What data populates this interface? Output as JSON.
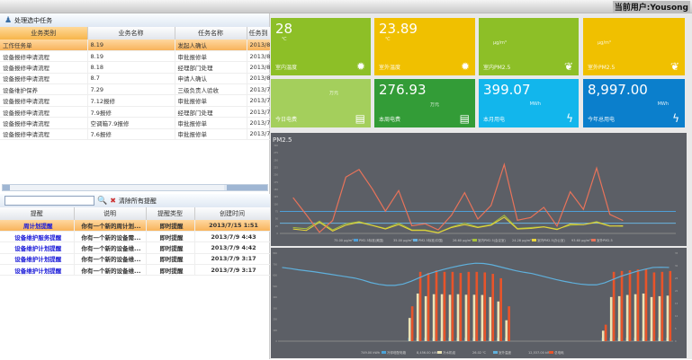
{
  "header": {
    "user": "当前用户:Yousong"
  },
  "tasks": {
    "toolbar_label": "处理选中任务",
    "columns": [
      "业务类别",
      "业务名称",
      "任务名称",
      "任务到"
    ],
    "rows": [
      [
        "工作任务单",
        "8.19",
        "发起人确认",
        "2013/8"
      ],
      [
        "设备报修申请流程",
        "8.19",
        "审批报修单",
        "2013/8"
      ],
      [
        "设备报修申请流程",
        "8.18",
        "经理部门处理",
        "2013/8"
      ],
      [
        "设备报修申请流程",
        "8.7",
        "申请人确认",
        "2013/8"
      ],
      [
        "设备维护保养",
        "7.29",
        "三级负责人验收",
        "2013/7"
      ],
      [
        "设备报修申请流程",
        "7.12报修",
        "审批报修单",
        "2013/7"
      ],
      [
        "设备报修申请流程",
        "7.9报修",
        "经理部门处理",
        "2013/7"
      ],
      [
        "设备报修申请流程",
        "空调箱7.9报修",
        "审批报修单",
        "2013/7"
      ],
      [
        "设备报修申请流程",
        "7.6报修",
        "审批报修单",
        "2013/7"
      ]
    ]
  },
  "reminders": {
    "search_value": "",
    "clear_label": "清除所有提醒",
    "columns": [
      "提醒",
      "说明",
      "提醒类型",
      "创建时间"
    ],
    "rows": [
      [
        "周计划提醒",
        "你有一个新的周计划...",
        "即时提醒",
        "2013/7/15 1:51"
      ],
      [
        "设备维护服务提醒",
        "你有一个新的设备需...",
        "即时提醒",
        "2013/7/9 4:43"
      ],
      [
        "设备维护计划提醒",
        "你有一个新的设备维...",
        "即时提醒",
        "2013/7/9 4:42"
      ],
      [
        "设备维护计划提醒",
        "你有一个新的设备维...",
        "即时提醒",
        "2013/7/9 3:17"
      ],
      [
        "设备维护计划提醒",
        "你有一个新的设备维...",
        "即时提醒",
        "2013/7/9 3:17"
      ]
    ]
  },
  "tiles": [
    {
      "value": "28",
      "unit": "℃",
      "label": "室内温度",
      "icon": "sun-icon",
      "color": "#8dbf27"
    },
    {
      "value": "23.89",
      "unit": "℃",
      "label": "室外温度",
      "icon": "sun-icon",
      "color": "#f0c000"
    },
    {
      "value": "",
      "unit": "μg/m³",
      "label": "室内PM2.5",
      "icon": "leaf-icon",
      "color": "#8dbf27"
    },
    {
      "value": "",
      "unit": "μg/m³",
      "label": "室外PM2.5",
      "icon": "leaf-icon",
      "color": "#f0c000"
    },
    {
      "value": "",
      "unit": "万元",
      "label": "今日电费",
      "icon": "money-icon",
      "color": "#a4cf5c"
    },
    {
      "value": "276.93",
      "unit": "万元",
      "label": "本周电费",
      "icon": "money-icon",
      "color": "#339c37"
    },
    {
      "value": "399.07",
      "unit": "MWh",
      "label": "本月用电",
      "icon": "lightning-icon",
      "color": "#12b6ec"
    },
    {
      "value": "8,997.00",
      "unit": "MWh",
      "label": "今年总用电",
      "icon": "lightning-icon",
      "color": "#0b7fcc"
    }
  ],
  "chart_data": [
    {
      "type": "line",
      "title": "PM2.5",
      "ylim": [
        0,
        300
      ],
      "grid": false,
      "legend": "bottom",
      "reference_lines": [
        {
          "name": "PM2.5标准(美国)",
          "value": 75,
          "legend_value": "75.00 μg/m³",
          "color": "#4f9fd8"
        },
        {
          "name": "PM2.5标准(中国)",
          "value": 35,
          "legend_value": "35.00 μg/m³",
          "color": "#6ab2e0"
        }
      ],
      "series": [
        {
          "name": "室内PM2.5(会议室)",
          "legend_value": "26.60 μg/m³",
          "color": "#a8c23a",
          "values": [
            20,
            16,
            42,
            12,
            33,
            40,
            28,
            17,
            35,
            12,
            12,
            3,
            22,
            35,
            22,
            30,
            62,
            17,
            20,
            23,
            15,
            28,
            30,
            40,
            26,
            24
          ]
        },
        {
          "name": "室内PM2.5(办公室)",
          "legend_value": "24.28 μg/m³",
          "color": "#e8d43c",
          "values": [
            15,
            10,
            38,
            8,
            28,
            38,
            27,
            15,
            30,
            10,
            10,
            2,
            20,
            30,
            20,
            28,
            55,
            15,
            17,
            22,
            13,
            32,
            30,
            38,
            25,
            26
          ]
        },
        {
          "name": "室外PM2.5",
          "legend_value": "93.60 μg/m³",
          "color": "#e8735a",
          "values": [
            122,
            64,
            4,
            44,
            192,
            218,
            152,
            76,
            146,
            26,
            33,
            12,
            62,
            139,
            49,
            95,
            235,
            45,
            54,
            89,
            25,
            142,
            82,
            223,
            65,
            44
          ]
        }
      ]
    },
    {
      "type": "bar",
      "ylim": [
        0,
        800
      ],
      "y2lim": [
        0,
        35
      ],
      "grid": false,
      "legend": "bottom",
      "series": [
        {
          "name": "冷却塔配电箱",
          "legend_value": "749.00 kWh",
          "color": "#4aa3d8",
          "type": "bar",
          "start": 16,
          "values": [
            30,
            30,
            30,
            30,
            30,
            30,
            30,
            30,
            30,
            30,
            30,
            30,
            30,
            null,
            null,
            null,
            null,
            null,
            null,
            null,
            null,
            null,
            null,
            null,
            30,
            30,
            30,
            30,
            30,
            30,
            30,
            30,
            30
          ]
        },
        {
          "name": "冷水机组",
          "legend_value": "8,456.00 kWh",
          "color": "#ebe3b5",
          "type": "bar",
          "start": 16,
          "values": [
            211,
            433,
            409,
            427,
            427,
            422,
            427,
            422,
            422,
            420,
            401,
            361,
            190,
            null,
            null,
            null,
            null,
            null,
            null,
            null,
            null,
            null,
            null,
            null,
            95,
            401,
            409,
            420,
            427,
            433,
            401,
            409,
            414
          ]
        },
        {
          "name": "总电耗",
          "legend_value": "12,537.00 kWh",
          "color": "#e8542a",
          "type": "bar",
          "start": 16,
          "values": [
            317,
            630,
            620,
            644,
            630,
            630,
            620,
            630,
            630,
            625,
            612,
            572,
            317,
            null,
            null,
            null,
            null,
            null,
            null,
            null,
            null,
            null,
            null,
            null,
            150,
            630,
            638,
            644,
            652,
            657,
            625,
            630,
            638
          ]
        },
        {
          "name": "室外温度",
          "legend_value": "26.02 ℃",
          "color": "#5fb0dc",
          "type": "line",
          "axis": "right",
          "values": [
            29.3,
            28.9,
            28.4,
            28.0,
            27.6,
            27.1,
            26.6,
            26.1,
            25.6,
            25.1,
            24.3,
            23.3,
            22.6,
            22.2,
            22.2,
            22.7,
            23.8,
            25.2,
            26.6,
            27.6,
            28.5,
            29.3,
            30.0,
            30.6,
            31.0,
            30.9,
            30.4,
            29.6,
            28.8,
            28.0,
            27.4,
            26.9,
            26.1,
            25.3,
            24.5,
            23.8,
            23.2,
            22.7,
            22.4,
            22.4,
            23.2,
            24.5,
            25.8,
            26.8,
            27.8,
            28.6,
            29.3,
            29.4,
            29.3
          ]
        }
      ]
    }
  ]
}
